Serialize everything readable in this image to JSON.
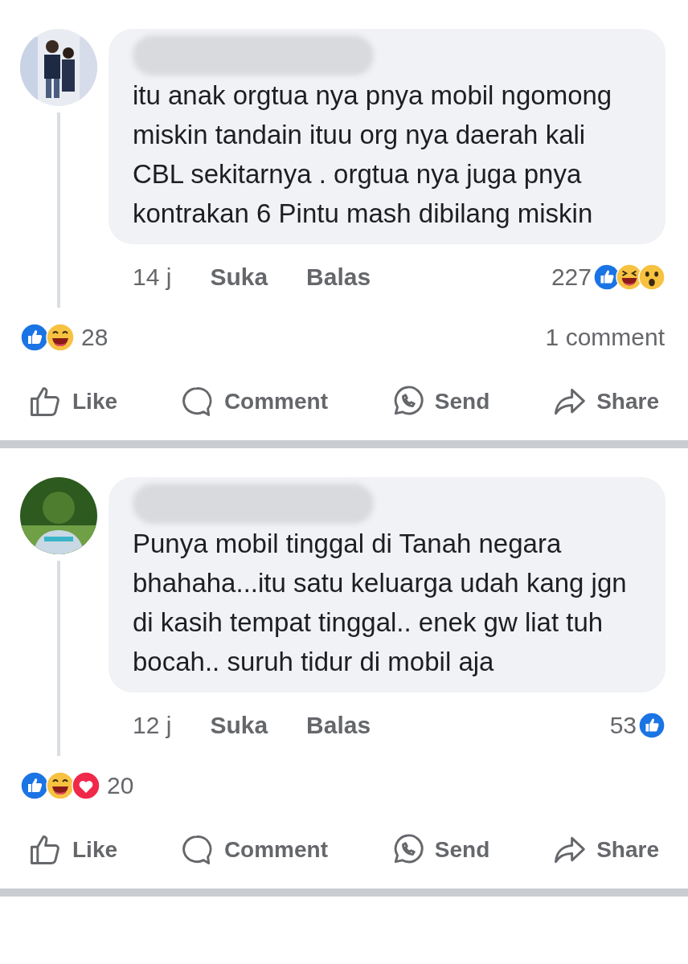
{
  "posts": [
    {
      "comment": {
        "text": "itu anak orgtua nya pnya mobil ngomong miskin tandain ituu org nya daerah kali CBL sekitarnya . orgtua nya juga pnya kontrakan 6 Pintu mash dibilang miskin",
        "time": "14 j",
        "like_label": "Suka",
        "reply_label": "Balas",
        "reaction_count": "227",
        "reactions": [
          {
            "kind": "like"
          },
          {
            "kind": "laugh"
          },
          {
            "kind": "wow"
          }
        ]
      },
      "summary": {
        "reactions": [
          {
            "kind": "like"
          },
          {
            "kind": "haha"
          }
        ],
        "count": "28",
        "comments": "1 comment"
      },
      "actions": [
        {
          "kind": "like",
          "label": "Like"
        },
        {
          "kind": "comment",
          "label": "Comment"
        },
        {
          "kind": "send",
          "label": "Send"
        },
        {
          "kind": "share",
          "label": "Share"
        }
      ]
    },
    {
      "comment": {
        "text": "Punya mobil tinggal di Tanah negara bhahaha...itu satu keluarga udah kang jgn di kasih tempat tinggal.. enek gw liat tuh bocah.. suruh tidur di mobil aja",
        "time": "12 j",
        "like_label": "Suka",
        "reply_label": "Balas",
        "reaction_count": "53",
        "reactions": [
          {
            "kind": "like"
          }
        ]
      },
      "summary": {
        "reactions": [
          {
            "kind": "like"
          },
          {
            "kind": "haha"
          },
          {
            "kind": "love"
          }
        ],
        "count": "20"
      },
      "actions": [
        {
          "kind": "like",
          "label": "Like"
        },
        {
          "kind": "comment",
          "label": "Comment"
        },
        {
          "kind": "send",
          "label": "Send"
        },
        {
          "kind": "share",
          "label": "Share"
        }
      ]
    }
  ]
}
